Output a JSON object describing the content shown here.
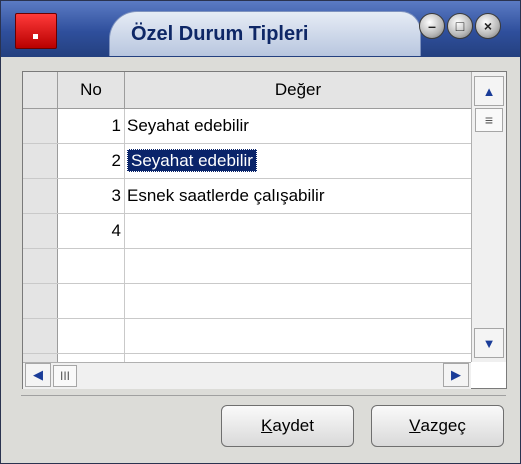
{
  "window": {
    "title": "Özel Durum Tipleri"
  },
  "titlebar_buttons": [
    {
      "name": "minimize",
      "glyph": "–"
    },
    {
      "name": "maximize",
      "glyph": "□"
    },
    {
      "name": "close",
      "glyph": "×"
    }
  ],
  "grid": {
    "headers": {
      "no": "No",
      "value": "Değer"
    },
    "rows": [
      {
        "no": "1",
        "value": "Seyahat edebilir",
        "selected": false
      },
      {
        "no": "2",
        "value": "Seyahat edebilir",
        "selected": true
      },
      {
        "no": "3",
        "value": "Esnek saatlerde çalışabilir",
        "selected": false
      },
      {
        "no": "4",
        "value": "",
        "selected": false
      },
      {
        "no": "",
        "value": "",
        "selected": false
      },
      {
        "no": "",
        "value": "",
        "selected": false
      },
      {
        "no": "",
        "value": "",
        "selected": false
      },
      {
        "no": "",
        "value": "",
        "selected": false
      }
    ]
  },
  "scrollbars": {
    "vertical": {
      "up": "▲",
      "down": "▼",
      "thumb": "≡"
    },
    "horizontal": {
      "left": "◀",
      "right": "▶",
      "thumb": "III"
    }
  },
  "buttons": {
    "save_prefix": "K",
    "save_rest": "aydet",
    "cancel_prefix": "V",
    "cancel_rest": "azgeç"
  },
  "colors": {
    "selection": "#0a246a",
    "titlebar": "#2f4f9c",
    "app_icon": "#e00000"
  }
}
